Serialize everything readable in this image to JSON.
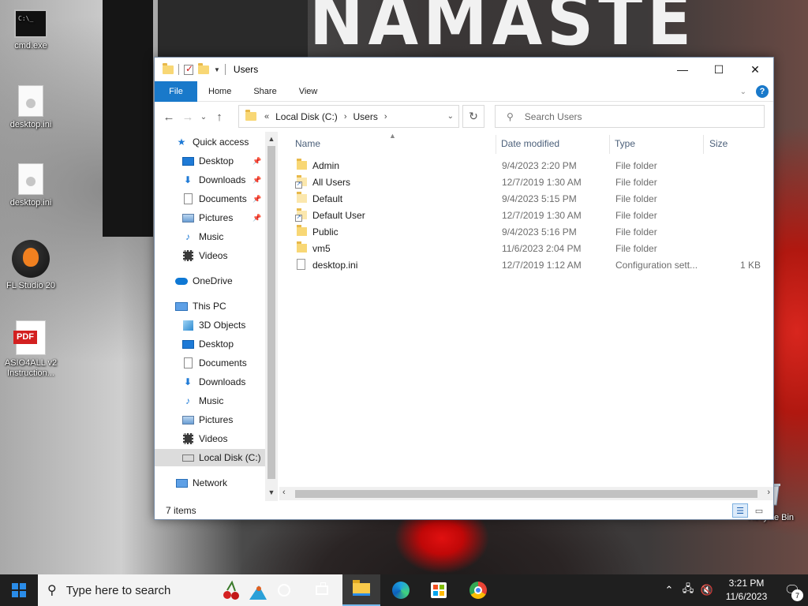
{
  "desktop": {
    "wallpaper_text": "NAMASTE",
    "icons": [
      {
        "label": "cmd.exe",
        "icon": "cmd-icon"
      },
      {
        "label": "desktop.ini",
        "icon": "ini-file-icon"
      },
      {
        "label": "desktop.ini",
        "icon": "ini-file-icon"
      },
      {
        "label": "FL Studio 20",
        "icon": "fl-studio-icon"
      },
      {
        "label": "ASIO4ALL v2 Instruction...",
        "icon": "pdf-icon",
        "badge": "PDF"
      },
      {
        "label": "Recycle Bin",
        "icon": "recycle-bin-icon"
      }
    ]
  },
  "window": {
    "title": "Users",
    "controls": {
      "minimize": "—",
      "maximize": "☐",
      "close": "✕"
    },
    "ribbon": {
      "tabs": [
        "File",
        "Home",
        "Share",
        "View"
      ],
      "help": "?"
    },
    "address": {
      "root": "Local Disk (C:)",
      "folder": "Users",
      "overflow": "«",
      "separator": "›"
    },
    "search": {
      "placeholder": "Search Users"
    },
    "nav": {
      "quick_access": {
        "label": "Quick access",
        "items": [
          {
            "label": "Desktop",
            "icon": "desktop-icon",
            "pinned": true
          },
          {
            "label": "Downloads",
            "icon": "downloads-icon",
            "pinned": true
          },
          {
            "label": "Documents",
            "icon": "documents-icon",
            "pinned": true
          },
          {
            "label": "Pictures",
            "icon": "pictures-icon",
            "pinned": true
          },
          {
            "label": "Music",
            "icon": "music-icon",
            "pinned": false
          },
          {
            "label": "Videos",
            "icon": "videos-icon",
            "pinned": false
          }
        ]
      },
      "onedrive": "OneDrive",
      "this_pc": {
        "label": "This PC",
        "items": [
          {
            "label": "3D Objects",
            "icon": "3d-objects-icon"
          },
          {
            "label": "Desktop",
            "icon": "desktop-icon"
          },
          {
            "label": "Documents",
            "icon": "documents-icon"
          },
          {
            "label": "Downloads",
            "icon": "downloads-icon"
          },
          {
            "label": "Music",
            "icon": "music-icon"
          },
          {
            "label": "Pictures",
            "icon": "pictures-icon"
          },
          {
            "label": "Videos",
            "icon": "videos-icon"
          },
          {
            "label": "Local Disk (C:)",
            "icon": "drive-icon",
            "selected": true
          }
        ]
      },
      "network": "Network"
    },
    "columns": [
      "Name",
      "Date modified",
      "Type",
      "Size"
    ],
    "files": [
      {
        "name": "Admin",
        "date": "9/4/2023 2:20 PM",
        "type": "File folder",
        "size": "",
        "icon": "folder"
      },
      {
        "name": "All Users",
        "date": "12/7/2019 1:30 AM",
        "type": "File folder",
        "size": "",
        "icon": "folder-link"
      },
      {
        "name": "Default",
        "date": "9/4/2023 5:15 PM",
        "type": "File folder",
        "size": "",
        "icon": "folder-hidden"
      },
      {
        "name": "Default User",
        "date": "12/7/2019 1:30 AM",
        "type": "File folder",
        "size": "",
        "icon": "folder-link"
      },
      {
        "name": "Public",
        "date": "9/4/2023 5:16 PM",
        "type": "File folder",
        "size": "",
        "icon": "folder"
      },
      {
        "name": "vm5",
        "date": "11/6/2023 2:04 PM",
        "type": "File folder",
        "size": "",
        "icon": "folder"
      },
      {
        "name": "desktop.ini",
        "date": "12/7/2019 1:12 AM",
        "type": "Configuration sett...",
        "size": "1 KB",
        "icon": "ini"
      }
    ],
    "status": {
      "item_count": "7 items"
    }
  },
  "taskbar": {
    "search_placeholder": "Type here to search",
    "apps": [
      "cortana-icon",
      "task-view-icon",
      "file-explorer-icon",
      "edge-icon",
      "store-icon",
      "chrome-icon"
    ],
    "clock": {
      "time": "3:21 PM",
      "date": "11/6/2023"
    },
    "notifications": "7"
  },
  "colors": {
    "accent": "#1979ca",
    "folder": "#f8d775",
    "taskbar": "#1f1f1f"
  }
}
